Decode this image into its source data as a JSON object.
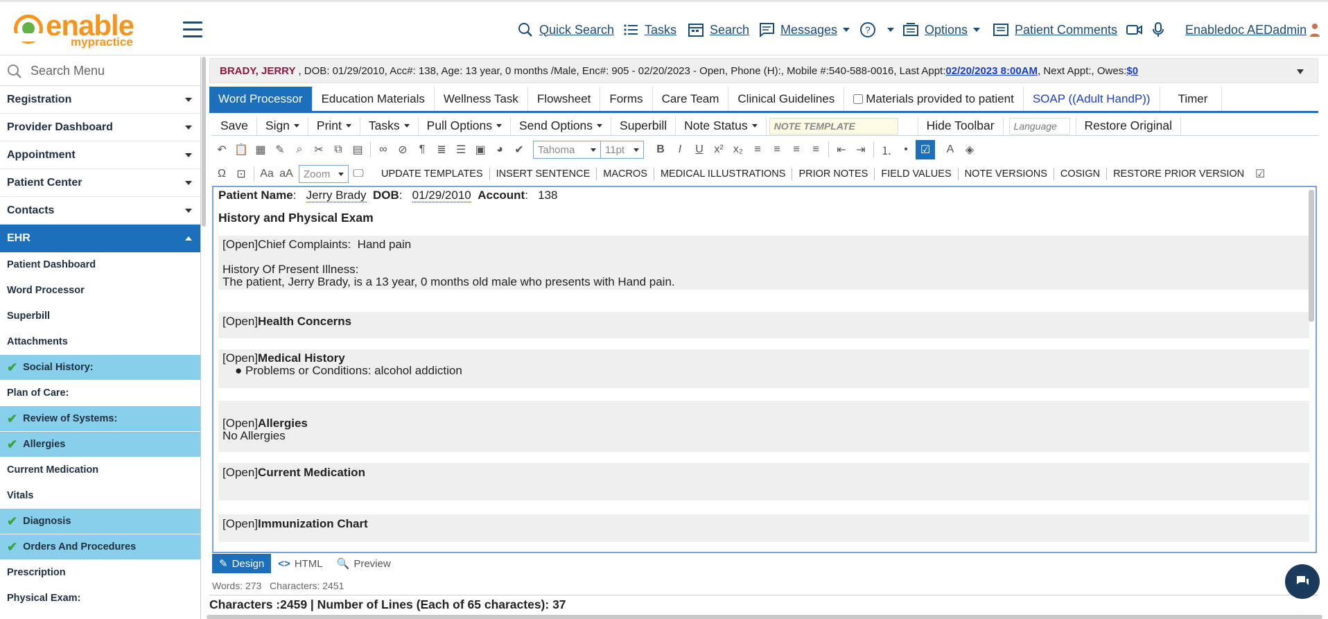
{
  "logo": {
    "brand": "enable",
    "sub": "mypractice",
    "colors": {
      "orange": "#f7941d",
      "green": "#62b246"
    }
  },
  "topnav": {
    "quick_search": "Quick Search",
    "tasks": "Tasks",
    "search": "Search",
    "messages": "Messages",
    "options": "Options",
    "patient_comments": "Patient Comments",
    "user": "Enabledoc AEDadmin"
  },
  "sidebar": {
    "search_placeholder": "Search Menu",
    "sections": [
      "Registration",
      "Provider Dashboard",
      "Appointment",
      "Patient Center",
      "Contacts"
    ],
    "active_section": "EHR",
    "items": [
      {
        "label": "Patient Dashboard",
        "checked": false
      },
      {
        "label": "Word Processor",
        "checked": false
      },
      {
        "label": "Superbill",
        "checked": false
      },
      {
        "label": "Attachments",
        "checked": false
      },
      {
        "label": "Social History:",
        "checked": true
      },
      {
        "label": "Plan of Care:",
        "checked": false
      },
      {
        "label": "Review of Systems:",
        "checked": true
      },
      {
        "label": "Allergies",
        "checked": true
      },
      {
        "label": "Current Medication",
        "checked": false
      },
      {
        "label": "Vitals",
        "checked": false
      },
      {
        "label": "Diagnosis",
        "checked": true
      },
      {
        "label": "Orders And Procedures",
        "checked": true
      },
      {
        "label": "Prescription",
        "checked": false
      },
      {
        "label": "Physical Exam:",
        "checked": false
      }
    ],
    "highlight_color": "#87cfea",
    "active_color": "#1c6fba"
  },
  "banner": {
    "name": "BRADY, JERRY",
    "info": ", DOB: 01/29/2010, Acc#: 138, Age: 13 year, 0 months /Male, Enc#: 905 - 02/20/2023 - Open, Phone (H):, Mobile #:540-588-0016, Last Appt:",
    "last_appt": "02/20/2023 8:00AM",
    "next_appt": ", Next Appt:, Owes:",
    "owes": "$0"
  },
  "tabs": {
    "word_processor": "Word Processor",
    "education": "Education Materials",
    "wellness": "Wellness Task",
    "flowsheet": "Flowsheet",
    "forms": "Forms",
    "care_team": "Care Team",
    "clinical": "Clinical Guidelines",
    "materials": "Materials provided to patient",
    "soap": "SOAP ((Adult HandP))",
    "timer": "Timer"
  },
  "toolbar": {
    "save": "Save",
    "sign": "Sign",
    "print": "Print",
    "tasks": "Tasks",
    "pull_options": "Pull Options",
    "send_options": "Send Options",
    "superbill": "Superbill",
    "note_status": "Note Status",
    "note_template": "NOTE TEMPLATE",
    "hide_toolbar": "Hide Toolbar",
    "language": "Language",
    "restore_original": "Restore Original",
    "font": "Tahoma",
    "size": "11pt",
    "zoom": "Zoom"
  },
  "actions": {
    "update_templates": "UPDATE TEMPLATES",
    "insert_sentence": "INSERT SENTENCE",
    "macros": "MACROS",
    "medical_illustrations": "MEDICAL ILLUSTRATIONS",
    "prior_notes": "PRIOR NOTES",
    "field_values": "FIELD VALUES",
    "note_versions": "NOTE VERSIONS",
    "cosign": "COSIGN",
    "restore_prior": "RESTORE PRIOR VERSION"
  },
  "document": {
    "pn_label": "Patient Name",
    "pn_value": "Jerry Brady",
    "dob_label": "DOB",
    "dob_value": "01/29/2010",
    "acc_label": "Account",
    "acc_value": "138",
    "title": "History and Physical Exam",
    "open_tag": "[Open]",
    "cc_label": "Chief Complaints:",
    "cc_value": "Hand pain",
    "hpi_label": "History Of Present Illness:",
    "hpi_text": "The patient, Jerry Brady, is a 13 year, 0 months old male who presents with Hand pain.",
    "health_concerns": "Health Concerns",
    "medical_history": "Medical History",
    "mh_item": "Problems or Conditions: alcohol addiction",
    "allergies": "Allergies",
    "allergies_value": "No Allergies",
    "current_medication": "Current Medication",
    "immunization": "Immunization Chart"
  },
  "modes": {
    "design": "Design",
    "html": "HTML",
    "preview": "Preview"
  },
  "counts": {
    "words_label": "Words:",
    "words": "273",
    "chars_label": "Characters:",
    "chars": "2451"
  },
  "footer": {
    "text": "Characters :2459 | Number of Lines (Each of 65 charactes): 37"
  }
}
